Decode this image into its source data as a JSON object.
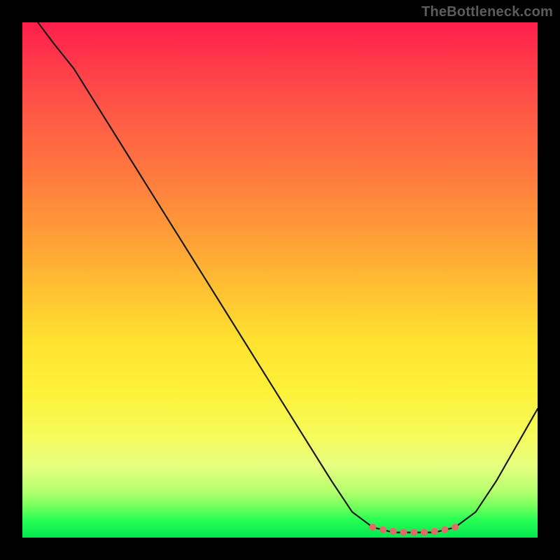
{
  "watermark": "TheBottleneck.com",
  "colors": {
    "page_bg": "#000000",
    "curve_stroke": "#1a1a1a",
    "marker_fill": "#e46a6a",
    "gradient": [
      "#ff1e4b",
      "#ff3a4a",
      "#ff5a46",
      "#ff7a3e",
      "#ffa037",
      "#ffc132",
      "#ffe22f",
      "#fdf23a",
      "#f6fb5a",
      "#e8fe80",
      "#b6ff6e",
      "#73ff5c",
      "#2bff55",
      "#00e84f"
    ]
  },
  "chart_data": {
    "type": "line",
    "title": "",
    "xlabel": "",
    "ylabel": "",
    "xlim": [
      0,
      100
    ],
    "ylim": [
      0,
      100
    ],
    "grid": false,
    "legend": false,
    "series": [
      {
        "name": "curve",
        "x": [
          3,
          6,
          10,
          15,
          20,
          25,
          30,
          35,
          40,
          45,
          50,
          55,
          60,
          64,
          68,
          72,
          76,
          80,
          84,
          88,
          92,
          96,
          100
        ],
        "values": [
          100,
          96,
          91,
          83,
          75,
          67,
          59,
          51,
          43,
          35,
          27,
          19,
          11,
          5,
          2,
          1,
          1,
          1,
          2,
          5,
          11,
          18,
          25
        ]
      }
    ],
    "markers": {
      "name": "flat-zone",
      "x": [
        68,
        70,
        72,
        74,
        76,
        78,
        80,
        82,
        84
      ],
      "values": [
        2.0,
        1.5,
        1.2,
        1.0,
        1.0,
        1.0,
        1.2,
        1.5,
        2.0
      ]
    }
  }
}
